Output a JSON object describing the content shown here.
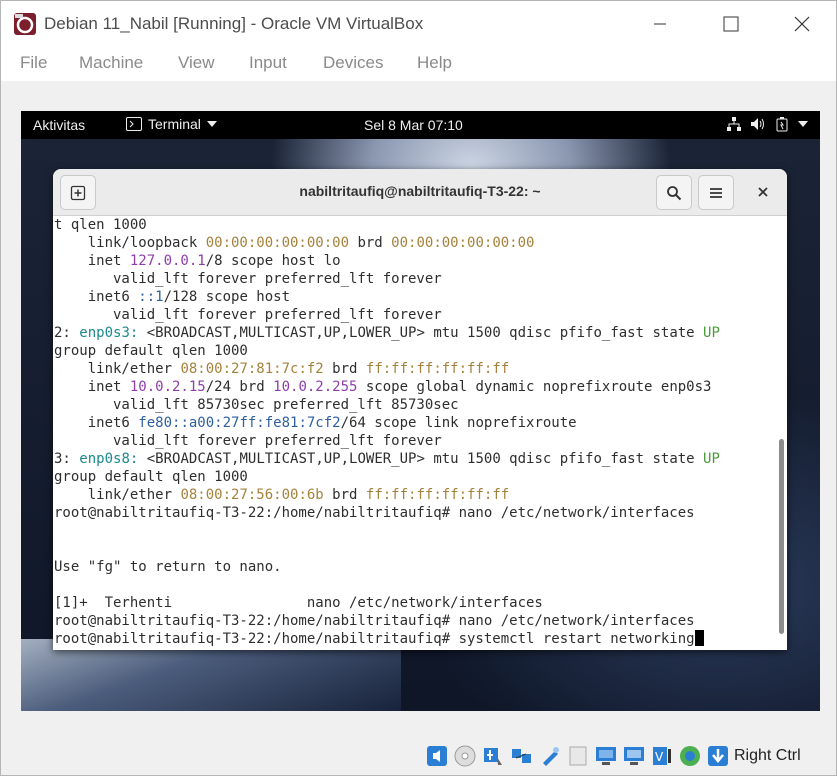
{
  "window": {
    "title": "Debian 11_Nabil [Running] - Oracle VM VirtualBox",
    "controls": [
      "minimize-icon",
      "maximize-icon",
      "close-icon"
    ]
  },
  "menu": {
    "items": [
      "File",
      "Machine",
      "View",
      "Input",
      "Devices",
      "Help"
    ]
  },
  "gnome": {
    "activities": "Aktivitas",
    "app_menu": "Terminal",
    "clock": "Sel 8 Mar  07:10",
    "tray_icons": [
      "network-icon",
      "volume-icon",
      "battery-icon",
      "chevron-down-icon"
    ]
  },
  "terminal": {
    "title": "nabiltritaufiq@nabiltritaufiq-T3-22: ~",
    "lines": [
      [
        [
          "t qlen 1000",
          ""
        ]
      ],
      [
        [
          "    link/loopback ",
          ""
        ],
        [
          "00:00:00:00:00:00",
          "c-gold"
        ],
        [
          " brd ",
          ""
        ],
        [
          "00:00:00:00:00:00",
          "c-gold"
        ]
      ],
      [
        [
          "    inet ",
          ""
        ],
        [
          "127.0.0.1",
          "c-purple"
        ],
        [
          "/8 scope host lo",
          ""
        ]
      ],
      [
        [
          "       valid_lft forever preferred_lft forever",
          ""
        ]
      ],
      [
        [
          "    inet6 ",
          ""
        ],
        [
          "::1",
          "c-blue"
        ],
        [
          "/128 scope host",
          ""
        ]
      ],
      [
        [
          "       valid_lft forever preferred_lft forever",
          ""
        ]
      ],
      [
        [
          "2: ",
          ""
        ],
        [
          "enp0s3:",
          "c-teal"
        ],
        [
          " <BROADCAST,MULTICAST,UP,LOWER_UP> mtu 1500 qdisc pfifo_fast state ",
          ""
        ],
        [
          "UP",
          "c-green"
        ]
      ],
      [
        [
          "group default qlen 1000",
          ""
        ]
      ],
      [
        [
          "    link/ether ",
          ""
        ],
        [
          "08:00:27:81:7c:f2",
          "c-gold"
        ],
        [
          " brd ",
          ""
        ],
        [
          "ff:ff:ff:ff:ff:ff",
          "c-gold"
        ]
      ],
      [
        [
          "    inet ",
          ""
        ],
        [
          "10.0.2.15",
          "c-purple"
        ],
        [
          "/24 brd ",
          ""
        ],
        [
          "10.0.2.255",
          "c-purple"
        ],
        [
          " scope global dynamic noprefixroute enp0s3",
          ""
        ]
      ],
      [
        [
          "       valid_lft 85730sec preferred_lft 85730sec",
          ""
        ]
      ],
      [
        [
          "    inet6 ",
          ""
        ],
        [
          "fe80::a00:27ff:fe81:7cf2",
          "c-blue"
        ],
        [
          "/64 scope link noprefixroute",
          ""
        ]
      ],
      [
        [
          "       valid_lft forever preferred_lft forever",
          ""
        ]
      ],
      [
        [
          "3: ",
          ""
        ],
        [
          "enp0s8:",
          "c-teal"
        ],
        [
          " <BROADCAST,MULTICAST,UP,LOWER_UP> mtu 1500 qdisc pfifo_fast state ",
          ""
        ],
        [
          "UP",
          "c-green"
        ]
      ],
      [
        [
          "group default qlen 1000",
          ""
        ]
      ],
      [
        [
          "    link/ether ",
          ""
        ],
        [
          "08:00:27:56:00:6b",
          "c-gold"
        ],
        [
          " brd ",
          ""
        ],
        [
          "ff:ff:ff:ff:ff:ff",
          "c-gold"
        ]
      ],
      [
        [
          "root@nabiltritaufiq-T3-22:/home/nabiltritaufiq# nano /etc/network/interfaces",
          ""
        ]
      ],
      [
        [
          "",
          ""
        ]
      ],
      [
        [
          "",
          ""
        ]
      ],
      [
        [
          "Use \"fg\" to return to nano.",
          ""
        ]
      ],
      [
        [
          "",
          ""
        ]
      ],
      [
        [
          "[1]+  Terhenti                nano /etc/network/interfaces",
          ""
        ]
      ],
      [
        [
          "root@nabiltritaufiq-T3-22:/home/nabiltritaufiq# nano /etc/network/interfaces",
          ""
        ]
      ],
      [
        [
          "root@nabiltritaufiq-T3-22:/home/nabiltritaufiq# systemctl restart networking",
          ""
        ]
      ]
    ]
  },
  "status": {
    "host_key": "Right Ctrl",
    "icons": [
      "audio-icon",
      "optical-drive-icon",
      "usb-icon",
      "network-adapter-icon",
      "shared-folders-icon",
      "clipboard-icon",
      "display-icon",
      "recording-icon",
      "cpu-virtualization-icon",
      "mouse-integration-icon",
      "keyboard-capture-icon"
    ]
  },
  "colors": {
    "purple": "#8e3ea8",
    "teal": "#1b8a8f",
    "gold": "#a5823c",
    "blue": "#2f5f9e",
    "green": "#4a9c3a"
  }
}
